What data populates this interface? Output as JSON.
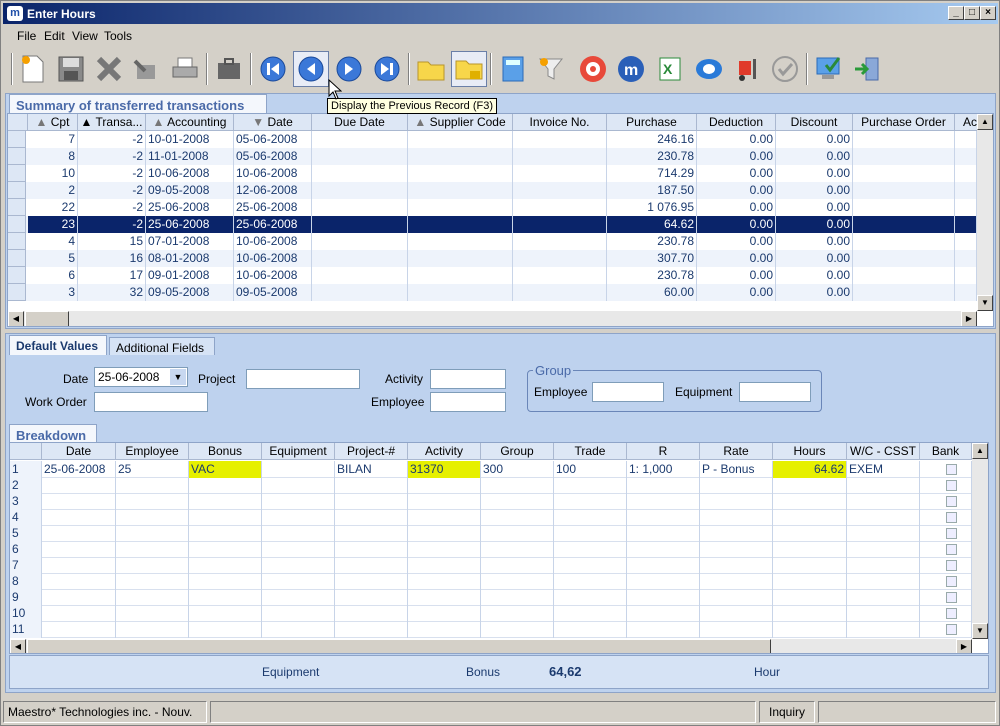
{
  "window": {
    "title": "Enter Hours",
    "app_icon": "m"
  },
  "menu": [
    "File",
    "Edit",
    "View",
    "Tools"
  ],
  "tooltip": "Display the Previous Record (F3)",
  "summary": {
    "tab_label": "Summary of transferred transactions",
    "columns": [
      "Cpt",
      "Transa...",
      "Accounting",
      "Date",
      "Due Date",
      "Supplier Code",
      "Invoice No.",
      "Purchase",
      "Deduction",
      "Discount",
      "Purchase Order",
      "Ac"
    ],
    "rows": [
      {
        "cpt": "7",
        "trans": "-2",
        "acct": "10-01-2008",
        "date": "05-06-2008",
        "purchase": "246.16",
        "deduction": "0.00",
        "discount": "0.00"
      },
      {
        "cpt": "8",
        "trans": "-2",
        "acct": "11-01-2008",
        "date": "05-06-2008",
        "purchase": "230.78",
        "deduction": "0.00",
        "discount": "0.00"
      },
      {
        "cpt": "10",
        "trans": "-2",
        "acct": "10-06-2008",
        "date": "10-06-2008",
        "purchase": "714.29",
        "deduction": "0.00",
        "discount": "0.00"
      },
      {
        "cpt": "2",
        "trans": "-2",
        "acct": "09-05-2008",
        "date": "12-06-2008",
        "purchase": "187.50",
        "deduction": "0.00",
        "discount": "0.00"
      },
      {
        "cpt": "22",
        "trans": "-2",
        "acct": "25-06-2008",
        "date": "25-06-2008",
        "purchase": "1 076.95",
        "deduction": "0.00",
        "discount": "0.00"
      },
      {
        "cpt": "23",
        "trans": "-2",
        "acct": "25-06-2008",
        "date": "25-06-2008",
        "purchase": "64.62",
        "deduction": "0.00",
        "discount": "0.00",
        "selected": true
      },
      {
        "cpt": "4",
        "trans": "15",
        "acct": "07-01-2008",
        "date": "10-06-2008",
        "purchase": "230.78",
        "deduction": "0.00",
        "discount": "0.00"
      },
      {
        "cpt": "5",
        "trans": "16",
        "acct": "08-01-2008",
        "date": "10-06-2008",
        "purchase": "307.70",
        "deduction": "0.00",
        "discount": "0.00"
      },
      {
        "cpt": "6",
        "trans": "17",
        "acct": "09-01-2008",
        "date": "10-06-2008",
        "purchase": "230.78",
        "deduction": "0.00",
        "discount": "0.00"
      },
      {
        "cpt": "3",
        "trans": "32",
        "acct": "09-05-2008",
        "date": "09-05-2008",
        "purchase": "60.00",
        "deduction": "0.00",
        "discount": "0.00"
      }
    ]
  },
  "detail_tabs": [
    "Default Values",
    "Additional Fields"
  ],
  "defaults": {
    "date_label": "Date",
    "date_value": "25-06-2008",
    "project_label": "Project",
    "activity_label": "Activity",
    "work_order_label": "Work Order",
    "employee_label": "Employee",
    "group_title": "Group",
    "group_employee_label": "Employee",
    "group_equipment_label": "Equipment"
  },
  "breakdown": {
    "tab_label": "Breakdown",
    "columns": [
      "Date",
      "Employee",
      "Bonus",
      "Equipment",
      "Project-#",
      "Activity",
      "Group",
      "Trade",
      "R",
      "Rate",
      "Hours",
      "W/C - CSST",
      "Bank"
    ],
    "row1": {
      "n": "1",
      "date": "25-06-2008",
      "employee": "25",
      "bonus": "VAC",
      "equipment": "",
      "project": "BILAN",
      "activity": "31370",
      "group": "300",
      "trade": "100",
      "r": "1: 1,000",
      "rate": "P -  Bonus",
      "hours": "64.62",
      "wc": "EXEM"
    },
    "empty_rows": [
      "2",
      "3",
      "4",
      "5",
      "6",
      "7",
      "8",
      "9",
      "10",
      "11"
    ]
  },
  "totals": {
    "equipment_label": "Equipment",
    "bonus_label": "Bonus",
    "bonus_value": "64,62",
    "hour_label": "Hour"
  },
  "status": {
    "left": "Maestro* Technologies inc. - Nouv.",
    "mode": "Inquiry"
  }
}
